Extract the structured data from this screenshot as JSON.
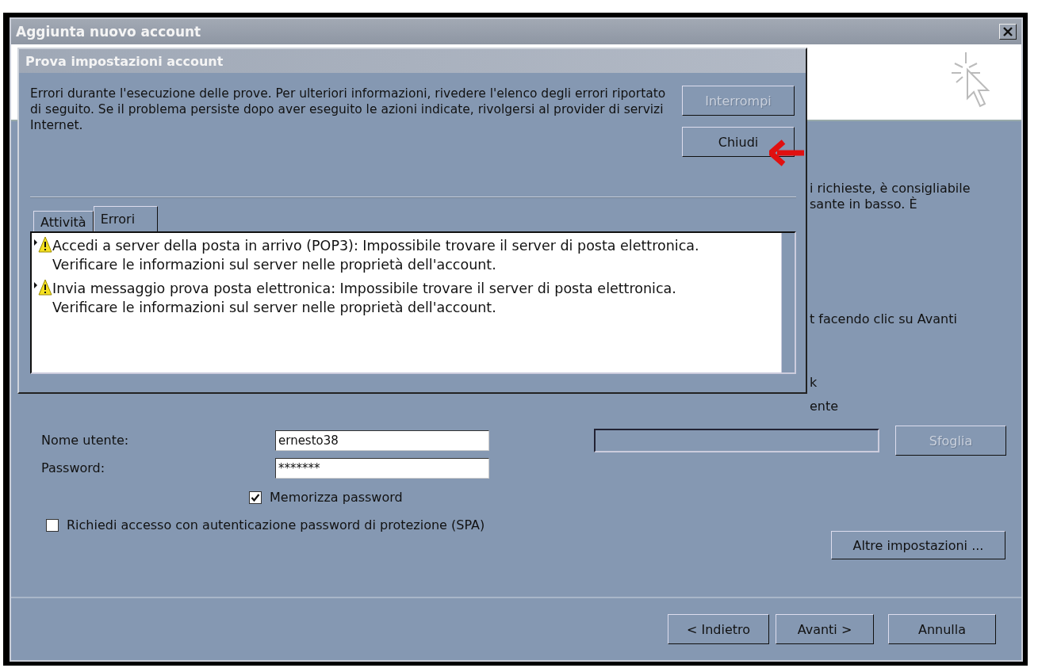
{
  "window": {
    "title": "Aggiunta nuovo account"
  },
  "background_texts": [
    {
      "text": "i richieste, è consigliabile"
    },
    {
      "text": "sante in basso. È"
    },
    {
      "text": "t facendo clic su Avanti"
    },
    {
      "text": "k"
    },
    {
      "text": "ente"
    }
  ],
  "account_form": {
    "username": {
      "label": "Nome utente:",
      "value": "ernesto38"
    },
    "password": {
      "label": "Password:",
      "value": "*******"
    },
    "remember_password": {
      "label": "Memorizza password",
      "checked": true
    },
    "spa": {
      "label": "Richiedi accesso con autenticazione password di protezione (SPA)",
      "checked": false
    }
  },
  "data_file": {
    "browse_button": {
      "label": "Sfoglia",
      "disabled": true
    }
  },
  "more_settings_button": {
    "label": "Altre impostazioni ..."
  },
  "nav_buttons": [
    {
      "label": "< Indietro"
    },
    {
      "label": "Avanti >"
    },
    {
      "label": "Annulla"
    }
  ],
  "dialog": {
    "title": "Prova impostazioni account",
    "message": "Errori durante l'esecuzione delle prove. Per ulteriori informazioni, rivedere l'elenco degli errori riportato di seguito. Se il problema persiste dopo aver eseguito le azioni indicate, rivolgersi al provider di servizi Internet.",
    "buttons": [
      {
        "label": "Interrompi",
        "disabled": true
      },
      {
        "label": "Chiudi",
        "disabled": false
      }
    ],
    "tabs": [
      {
        "label": "Attività",
        "selected": false
      },
      {
        "label": "Errori",
        "selected": true
      }
    ],
    "errors": [
      {
        "text": "Accedi a server della posta in arrivo (POP3): Impossibile trovare il server di posta elettronica.",
        "detail": "Verificare le informazioni sul server nelle proprietà dell'account."
      },
      {
        "text": "Invia messaggio prova posta elettronica: Impossibile trovare il server di posta elettronica.",
        "detail": "Verificare le informazioni sul server nelle proprietà dell'account."
      }
    ]
  }
}
